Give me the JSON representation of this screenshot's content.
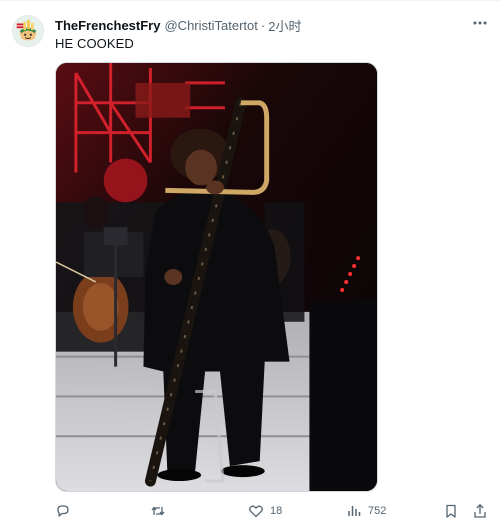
{
  "tweet": {
    "display_name": "TheFrenchestFry",
    "handle": "@ChristiTatertot",
    "separator": "·",
    "time": "2小时",
    "text": "HE COOKED",
    "likes": "18",
    "views": "752"
  },
  "icons": {
    "more": "more-icon",
    "reply": "reply-icon",
    "retweet": "retweet-icon",
    "like": "heart-icon",
    "views": "views-icon",
    "bookmark": "bookmark-icon",
    "share": "share-icon"
  },
  "colors": {
    "text": "#0f1419",
    "secondary": "#536471",
    "stage_red": "#d8192a"
  }
}
